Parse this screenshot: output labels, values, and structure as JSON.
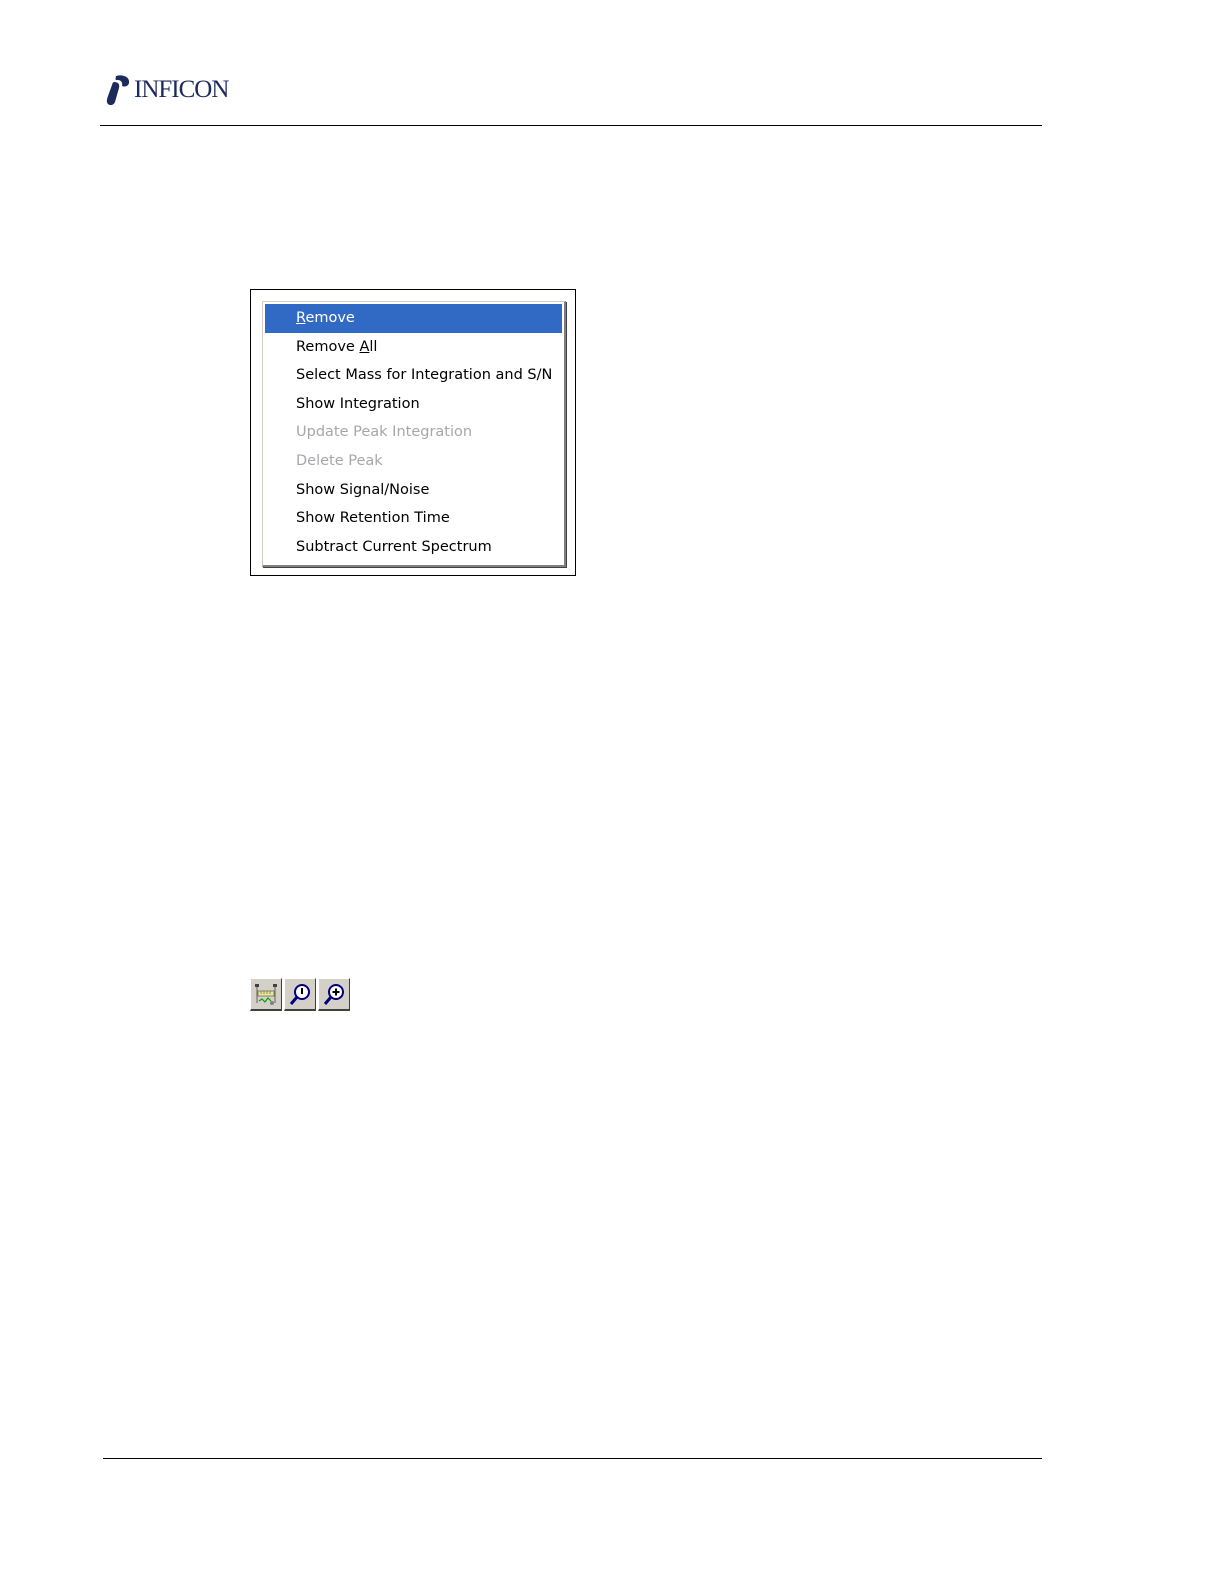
{
  "header": {
    "brand": "INFICON"
  },
  "context_menu": {
    "items": [
      {
        "before": "",
        "mnemonic": "R",
        "after": "emove",
        "state": "selected"
      },
      {
        "before": "Remove ",
        "mnemonic": "A",
        "after": "ll",
        "state": "enabled"
      },
      {
        "before": "Select Mass for Integration and S/N",
        "mnemonic": "",
        "after": "",
        "state": "enabled"
      },
      {
        "before": "Show Integration",
        "mnemonic": "",
        "after": "",
        "state": "enabled"
      },
      {
        "before": "Update Peak Integration",
        "mnemonic": "",
        "after": "",
        "state": "disabled"
      },
      {
        "before": "Delete Peak",
        "mnemonic": "",
        "after": "",
        "state": "disabled"
      },
      {
        "before": "Show Signal/Noise",
        "mnemonic": "",
        "after": "",
        "state": "enabled"
      },
      {
        "before": "Show Retention Time",
        "mnemonic": "",
        "after": "",
        "state": "enabled"
      },
      {
        "before": "Subtract Current Spectrum",
        "mnemonic": "",
        "after": "",
        "state": "enabled"
      }
    ]
  },
  "toolbar": {
    "buttons": [
      {
        "icon": "spectrum-ruler-icon"
      },
      {
        "icon": "zoom-reset-icon"
      },
      {
        "icon": "zoom-in-icon"
      }
    ]
  },
  "colors": {
    "selection": "#316ac5",
    "disabled_text": "#a7a6aa",
    "button_face": "#d4d0c8",
    "brand": "#1d2a5c"
  }
}
